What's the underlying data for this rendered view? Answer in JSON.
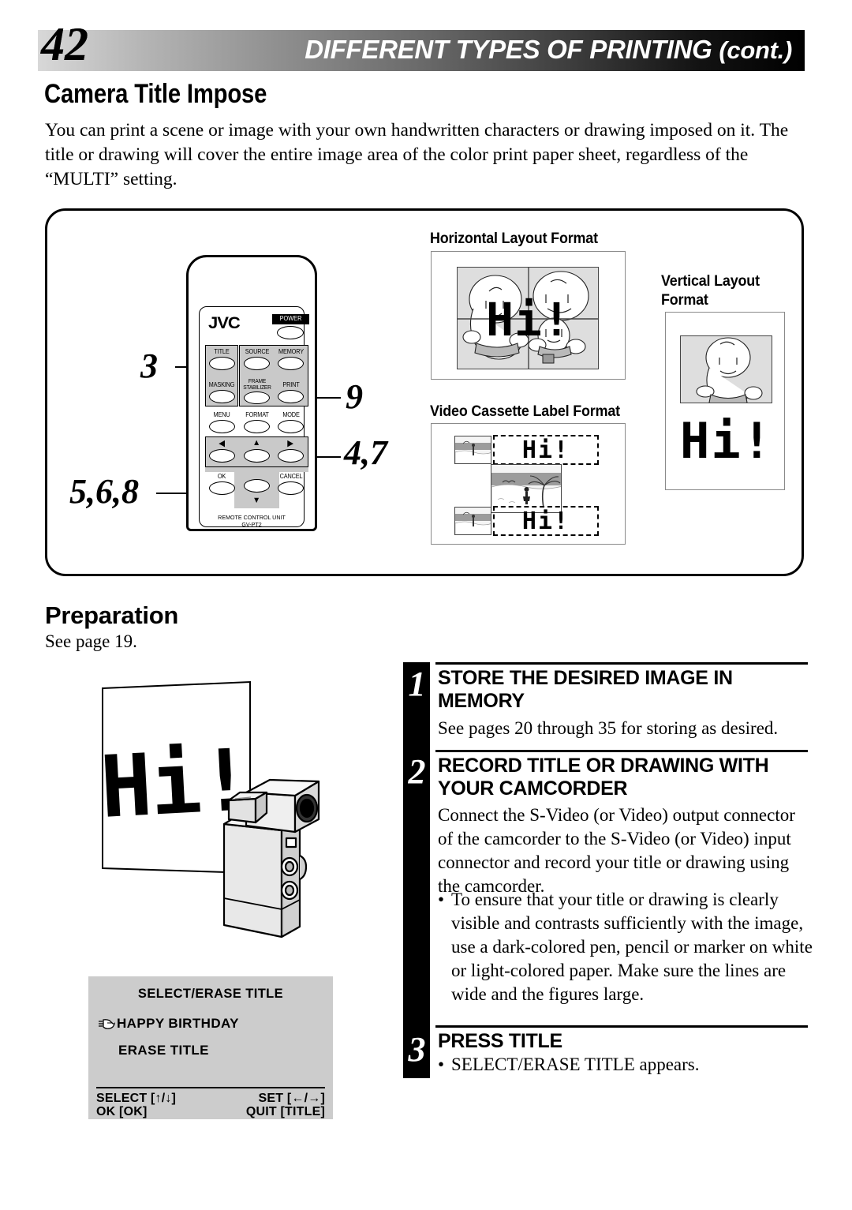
{
  "header": {
    "page_number": "42",
    "title_main": "DIFFERENT TYPES OF PRINTING",
    "title_cont": "(cont.)"
  },
  "section": {
    "title": "Camera Title Impose",
    "intro": "You can print a scene or image with your own handwritten characters or drawing imposed on it. The title or drawing will cover the entire image area of the color print paper sheet, regardless of the “MULTI” setting."
  },
  "remote": {
    "brand": "JVC",
    "power_label": "POWER",
    "buttons": {
      "title": "TITLE",
      "source": "SOURCE",
      "memory": "MEMORY",
      "masking": "MASKING",
      "frame": "FRAME",
      "stabilizer": "STABILIZER",
      "print": "PRINT",
      "menu": "MENU",
      "format": "FORMAT",
      "mode": "MODE",
      "ok": "OK",
      "cancel": "CANCEL",
      "left_arrow": "◀",
      "up_arrow": "▲",
      "right_arrow": "▶",
      "down_arrow": "▼"
    },
    "footer_line1": "REMOTE CONTROL UNIT",
    "footer_line2": "GV-PT2",
    "callouts": {
      "left_top": "3",
      "left_bottom": "5,6,8",
      "right_top": "9",
      "right_bottom": "4,7"
    }
  },
  "formats": {
    "horizontal_label": "Horizontal Layout Format",
    "vertical_label_line1": "Vertical Layout",
    "vertical_label_line2": "Format",
    "cassette_label": "Video Cassette Label Format",
    "overlay_text": "Hi!"
  },
  "preparation": {
    "heading": "Preparation",
    "text": "See page 19."
  },
  "steps": [
    {
      "number": "1",
      "heading": "STORE THE DESIRED IMAGE IN MEMORY",
      "body": "See pages 20 through 35 for storing as desired."
    },
    {
      "number": "2",
      "heading": "RECORD TITLE OR DRAWING WITH YOUR CAMCORDER",
      "body": "Connect the S-Video (or Video) output connector of the camcorder to the S-Video (or Video) input connector and record your title or drawing using the camcorder.",
      "bullet": "To ensure that your title or drawing is clearly visible and contrasts sufficiently with the image, use a dark-colored pen, pencil or marker on white or light-colored paper. Make sure the lines are wide and the figures large."
    },
    {
      "number": "3",
      "heading": "PRESS TITLE",
      "bullet": "SELECT/ERASE TITLE appears."
    }
  ],
  "illustration": {
    "paper_text": "Hi!"
  },
  "lcd": {
    "title": "SELECT/ERASE  TITLE",
    "item_selected": "HAPPY  BIRTHDAY",
    "item_second": "ERASE  TITLE",
    "footer_select": "SELECT [↑/↓]",
    "footer_set": "SET [←/→]",
    "footer_ok": "OK [OK]",
    "footer_quit": "QUIT [TITLE]"
  },
  "colors": {
    "lcd_bg": "#cccccc",
    "photo_bg": "#dedede",
    "button_group_bg": "#c9c9c9",
    "header_dark": "#000000"
  }
}
